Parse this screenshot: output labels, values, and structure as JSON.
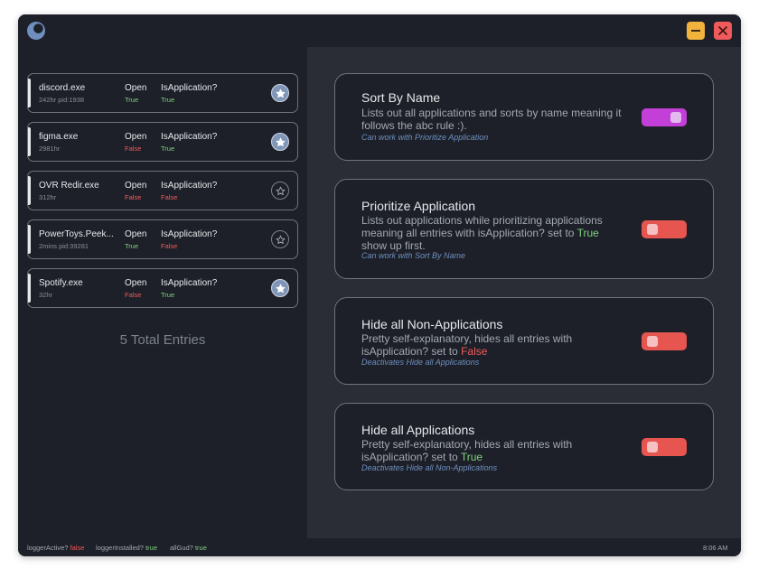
{
  "colors": {
    "true": "#7fd37f",
    "false": "#f05a5a",
    "toggle_on": "#c23fd8",
    "toggle_off": "#e6554f",
    "accent": "#6f8fbf"
  },
  "icons": {
    "logo": "moon-logo-icon",
    "minimize": "minimize-icon",
    "close": "close-icon",
    "star": "star-icon"
  },
  "entries": [
    {
      "name": "discord.exe",
      "sub": "242hr pid:1938",
      "open_label": "Open",
      "open_value": "True",
      "isapp_label": "IsApplication?",
      "isapp_value": "True",
      "starred": true
    },
    {
      "name": "figma.exe",
      "sub": "2981hr",
      "open_label": "Open",
      "open_value": "False",
      "isapp_label": "IsApplication?",
      "isapp_value": "True",
      "starred": true
    },
    {
      "name": "OVR Redir.exe",
      "sub": "312hr",
      "open_label": "Open",
      "open_value": "False",
      "isapp_label": "IsApplication?",
      "isapp_value": "False",
      "starred": false
    },
    {
      "name": "PowerToys.Peek...",
      "sub": "2mins pid:39281",
      "open_label": "Open",
      "open_value": "True",
      "isapp_label": "IsApplication?",
      "isapp_value": "False",
      "starred": false
    },
    {
      "name": "Spotify.exe",
      "sub": "32hr",
      "open_label": "Open",
      "open_value": "False",
      "isapp_label": "IsApplication?",
      "isapp_value": "True",
      "starred": true
    }
  ],
  "total_entries": "5 Total Entries",
  "settings": [
    {
      "title": "Sort By Name",
      "desc_before": "Lists out all applications and sorts by name meaning it follows the abc rule :).",
      "desc_value": "",
      "desc_after": "",
      "note": "Can work with Prioritize Application",
      "enabled": true
    },
    {
      "title": "Prioritize Application",
      "desc_before": "Lists out applications while prioritizing applications meaning all entries with isApplication? set to ",
      "desc_value": "True",
      "desc_after": " show up first.",
      "note": "Can work with Sort By Name",
      "enabled": false
    },
    {
      "title": "Hide all Non-Applications",
      "desc_before": "Pretty self-explanatory, hides all entries with isApplication? set to ",
      "desc_value": "False",
      "desc_after": "",
      "note": "Deactivates Hide all Applications",
      "enabled": false
    },
    {
      "title": "Hide all Applications",
      "desc_before": "Pretty self-explanatory, hides all entries with isApplication? set to ",
      "desc_value": "True",
      "desc_after": "",
      "note": "Deactivates Hide all Non-Applications",
      "enabled": false
    }
  ],
  "status": {
    "logger_active_label": "loggerActive?",
    "logger_active_value": "false",
    "logger_installed_label": "loggerInstalled?",
    "logger_installed_value": "true",
    "allgud_label": "allGud?",
    "allgud_value": "true",
    "time": "8:06 AM"
  }
}
